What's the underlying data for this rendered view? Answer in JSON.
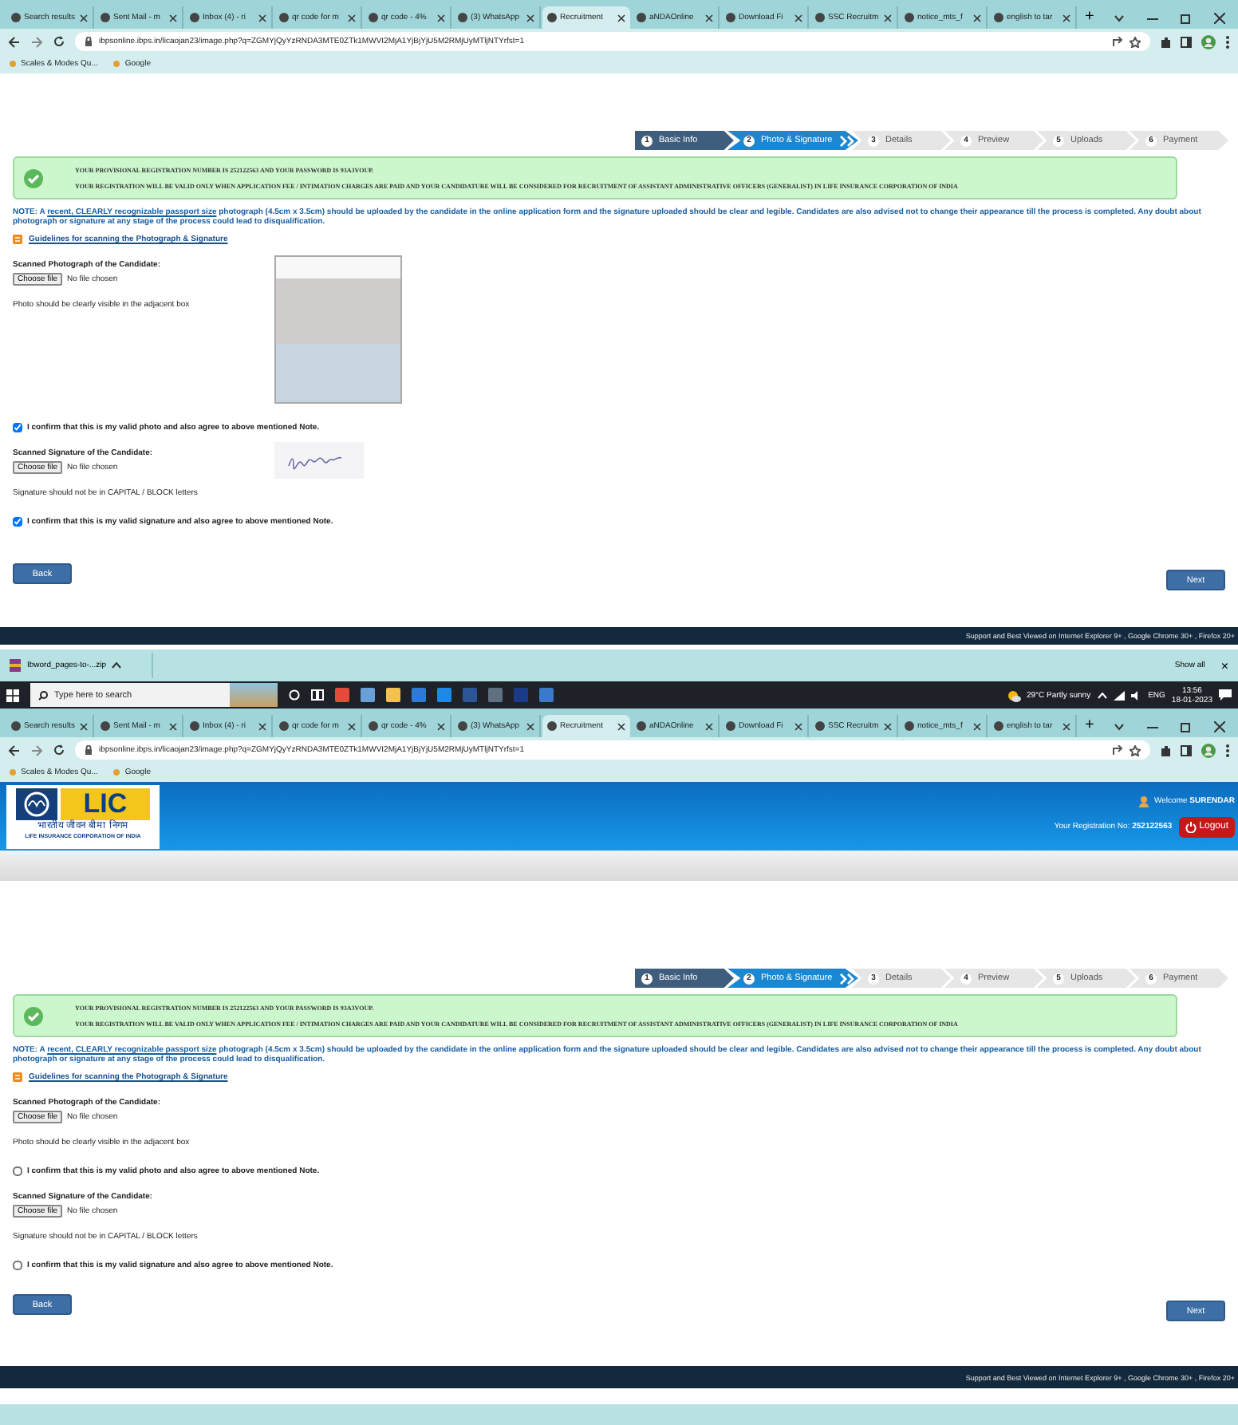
{
  "captures": [
    {
      "browser": {
        "tabs": [
          {
            "title": "Search results",
            "selected": false
          },
          {
            "title": "Sent Mail - m",
            "selected": false
          },
          {
            "title": "Inbox (4) - ri",
            "selected": false
          },
          {
            "title": "qr code for m",
            "selected": false
          },
          {
            "title": "qr code - 4%",
            "selected": false
          },
          {
            "title": "(3) WhatsApp",
            "selected": false
          },
          {
            "title": "Recruitment",
            "selected": true
          },
          {
            "title": "aNDAOnline",
            "selected": false
          },
          {
            "title": "Download Fi",
            "selected": false
          },
          {
            "title": "SSC Recruitm",
            "selected": false
          },
          {
            "title": "notice_mts_f",
            "selected": false
          },
          {
            "title": "english to tar",
            "selected": false
          }
        ],
        "new_tab": "+",
        "url": "ibpsonline.ibps.in/licaojan23/image.php?q=ZGMYjQyYzRNDA3MTE0ZTk1MWVI2MjA1YjBjYjU5M2RMjUyMTljNTYrfst=1",
        "bookmarks": [
          "Scales & Modes Qu...",
          "Google"
        ]
      },
      "steps": [
        {
          "number": "1",
          "label": "Basic Info",
          "completed": true,
          "selected": false
        },
        {
          "number": "2",
          "label": "Photo & Signature",
          "completed": false,
          "selected": true
        },
        {
          "number": "3",
          "label": "Details",
          "completed": false,
          "selected": false
        },
        {
          "number": "4",
          "label": "Preview",
          "completed": false,
          "selected": false
        },
        {
          "number": "5",
          "label": "Uploads",
          "completed": false,
          "selected": false
        },
        {
          "number": "6",
          "label": "Payment",
          "completed": false,
          "selected": false
        }
      ],
      "alert": [
        "YOUR PROVISIONAL REGISTRATION NUMBER IS 252122563 AND YOUR PASSWORD IS 93A3VOUP.",
        "YOUR REGISTRATION WILL BE VALID ONLY WHEN APPLICATION FEE / INTIMATION CHARGES ARE PAID AND YOUR CANDIDATURE WILL BE CONSIDERED FOR RECRUITMENT OF ASSISTANT ADMINISTRATIVE OFFICERS (GENERALIST) IN LIFE INSURANCE CORPORATION OF INDIA"
      ],
      "note": "NOTE: A **recent, CLEARLY recognizable passport size** photograph (4.5cm x 3.5cm) should be uploaded by the candidate in the online application form and the signature uploaded should be clear and legible. Candidates are also advised not to change their appearance till the process is completed. Any doubt about photograph or signature at any stage of the process could lead to disqualification.",
      "guidelines_link": "Guidelines for scanning the Photograph & Signature",
      "uploads": [
        {
          "kind": "photo",
          "label": "Scanned Photograph of the Candidate:",
          "button": "Choose file",
          "file_status": "No file chosen",
          "hint": "Photo should be clearly visible in the adjacent box",
          "confirm": {
            "text": "I confirm that this is my valid photo and also agree to above mentioned Note.",
            "checked": true
          }
        },
        {
          "kind": "signature",
          "label": "Scanned Signature of the Candidate:",
          "button": "Choose file",
          "file_status": "No file chosen",
          "hint": "Signature should not be in CAPITAL / BLOCK letters",
          "confirm": {
            "text": "I confirm that this is my valid signature and also agree to above mentioned Note.",
            "checked": true
          }
        }
      ],
      "back_button": "Back",
      "next_button": "Next",
      "footer": "Support and Best Viewed on Internet Explorer 9+ , Google Chrome 30+ , Firefox 20+",
      "downloads_bar": {
        "file": "Ibword_pages-to-...zip",
        "show_all": "Show all",
        "close": "×"
      },
      "taskbar": {
        "search_placeholder": "Type here to search",
        "weather": "29°C  Partly sunny",
        "language": "ENG",
        "time": "13:56",
        "date": "18-01-2023"
      }
    },
    {
      "browser": {
        "tabs": [
          {
            "title": "Search results",
            "selected": false
          },
          {
            "title": "Sent Mail - m",
            "selected": false
          },
          {
            "title": "Inbox (4) - ri",
            "selected": false
          },
          {
            "title": "qr code for m",
            "selected": false
          },
          {
            "title": "qr code - 4%",
            "selected": false
          },
          {
            "title": "(3) WhatsApp",
            "selected": false
          },
          {
            "title": "Recruitment",
            "selected": true
          },
          {
            "title": "aNDAOnline",
            "selected": false
          },
          {
            "title": "Download Fi",
            "selected": false
          },
          {
            "title": "SSC Recruitm",
            "selected": false
          },
          {
            "title": "notice_mts_f",
            "selected": false
          },
          {
            "title": "english to tar",
            "selected": false
          }
        ],
        "new_tab": "+",
        "url": "ibpsonline.ibps.in/licaojan23/image.php?q=ZGMYjQyYzRNDA3MTE0ZTk1MWVI2MjA1YjBjYjU5M2RMjUyMTljNTYrfst=1",
        "bookmarks": [
          "Scales & Modes Qu...",
          "Google"
        ]
      },
      "site_header": {
        "logo_text": "LIC",
        "logo_hindi": "भारतीय जीवन बीमा निगम",
        "logo_english": "LIFE INSURANCE CORPORATION OF INDIA",
        "welcome": "Welcome **SURENDAR**",
        "registration": "Your Registration No: **252122563**",
        "logout_button": "Logout"
      },
      "steps": [
        {
          "number": "1",
          "label": "Basic Info",
          "completed": true,
          "selected": false
        },
        {
          "number": "2",
          "label": "Photo & Signature",
          "completed": false,
          "selected": true
        },
        {
          "number": "3",
          "label": "Details",
          "completed": false,
          "selected": false
        },
        {
          "number": "4",
          "label": "Preview",
          "completed": false,
          "selected": false
        },
        {
          "number": "5",
          "label": "Uploads",
          "completed": false,
          "selected": false
        },
        {
          "number": "6",
          "label": "Payment",
          "completed": false,
          "selected": false
        }
      ],
      "alert": [
        "YOUR PROVISIONAL REGISTRATION NUMBER IS 252122563 AND YOUR PASSWORD IS 93A3VOUP.",
        "YOUR REGISTRATION WILL BE VALID ONLY WHEN APPLICATION FEE / INTIMATION CHARGES ARE PAID AND YOUR CANDIDATURE WILL BE CONSIDERED FOR RECRUITMENT OF ASSISTANT ADMINISTRATIVE OFFICERS (GENERALIST) IN LIFE INSURANCE CORPORATION OF INDIA"
      ],
      "note": "NOTE: A **recent, CLEARLY recognizable passport size** photograph (4.5cm x 3.5cm) should be uploaded by the candidate in the online application form and the signature uploaded should be clear and legible. Candidates are also advised not to change their appearance till the process is completed. Any doubt about photograph or signature at any stage of the process could lead to disqualification.",
      "guidelines_link": "Guidelines for scanning the Photograph & Signature",
      "uploads": [
        {
          "label": "Scanned Photograph of the Candidate:",
          "button": "Choose file",
          "file_status": "No file chosen",
          "hint": "Photo should be clearly visible in the adjacent box",
          "confirm": {
            "text": "I confirm that this is my valid photo and also agree to above mentioned Note.",
            "checked": false
          }
        },
        {
          "label": "Scanned Signature of the Candidate:",
          "button": "Choose file",
          "file_status": "No file chosen",
          "hint": "Signature should not be in CAPITAL / BLOCK letters",
          "confirm": {
            "text": "I confirm that this is my valid signature and also agree to above mentioned Note.",
            "checked": false
          }
        }
      ],
      "back_button": "Back",
      "next_button": "Next",
      "footer": "Support and Best Viewed on Internet Explorer 9+ , Google Chrome 30+ , Firefox 20+"
    }
  ]
}
